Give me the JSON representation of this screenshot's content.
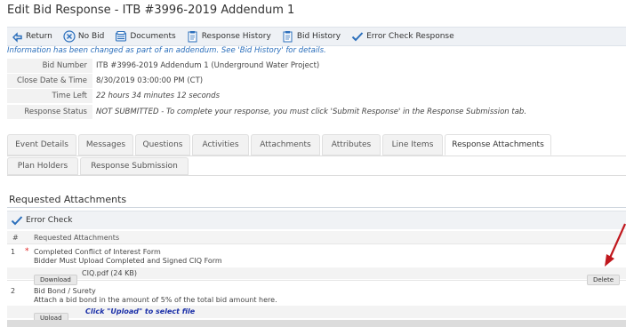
{
  "page": {
    "title": "Edit Bid Response - ITB #3996-2019 Addendum 1"
  },
  "toolbar": {
    "items": [
      {
        "label": "Return",
        "icon": "return-arrow-icon"
      },
      {
        "label": "No Bid",
        "icon": "no-bid-icon"
      },
      {
        "label": "Documents",
        "icon": "documents-icon"
      },
      {
        "label": "Response History",
        "icon": "history-icon"
      },
      {
        "label": "Bid History",
        "icon": "bid-history-icon"
      },
      {
        "label": "Error Check Response",
        "icon": "checkmark-icon"
      }
    ]
  },
  "info_message": "Information has been changed as part of an addendum. See 'Bid History' for details.",
  "details": {
    "bid_number_label": "Bid Number",
    "bid_number": "ITB #3996-2019 Addendum 1 (Underground Water Project)",
    "close_label": "Close Date & Time",
    "close_value": "8/30/2019 03:00:00 PM (CT)",
    "time_left_label": "Time Left",
    "time_left_value": "22 hours 34 minutes 12 seconds",
    "status_label": "Response Status",
    "status_value": "NOT SUBMITTED - To complete your response, you must click 'Submit Response' in the Response Submission tab."
  },
  "tabs_row1": [
    "Event Details",
    "Messages",
    "Questions",
    "Activities",
    "Attachments",
    "Attributes",
    "Line Items",
    "Response Attachments"
  ],
  "tabs_row2": [
    "Plan Holders",
    "Response Submission"
  ],
  "active_tab": "Response Attachments",
  "section": {
    "title": "Requested Attachments",
    "error_check_label": "Error Check",
    "col_num": "#",
    "col_attachments": "Requested Attachments"
  },
  "attachments": [
    {
      "num": "1",
      "required": "*",
      "name": "Completed Conflict of Interest Form",
      "description": "Bidder Must Upload Completed and Signed CIQ Form",
      "action_button": "Download",
      "file": "CIQ.pdf (24 KB)",
      "delete_button": "Delete"
    },
    {
      "num": "2",
      "name": "Bid Bond / Surety",
      "description": "Attach a bid bond in the amount of 5% of the total bid amount here.",
      "action_button": "Upload",
      "hint": "Click \"Upload\" to select file"
    }
  ],
  "colors": {
    "accent": "#2a6ebb",
    "alert": "#e02020",
    "arrow": "#c0171d"
  }
}
